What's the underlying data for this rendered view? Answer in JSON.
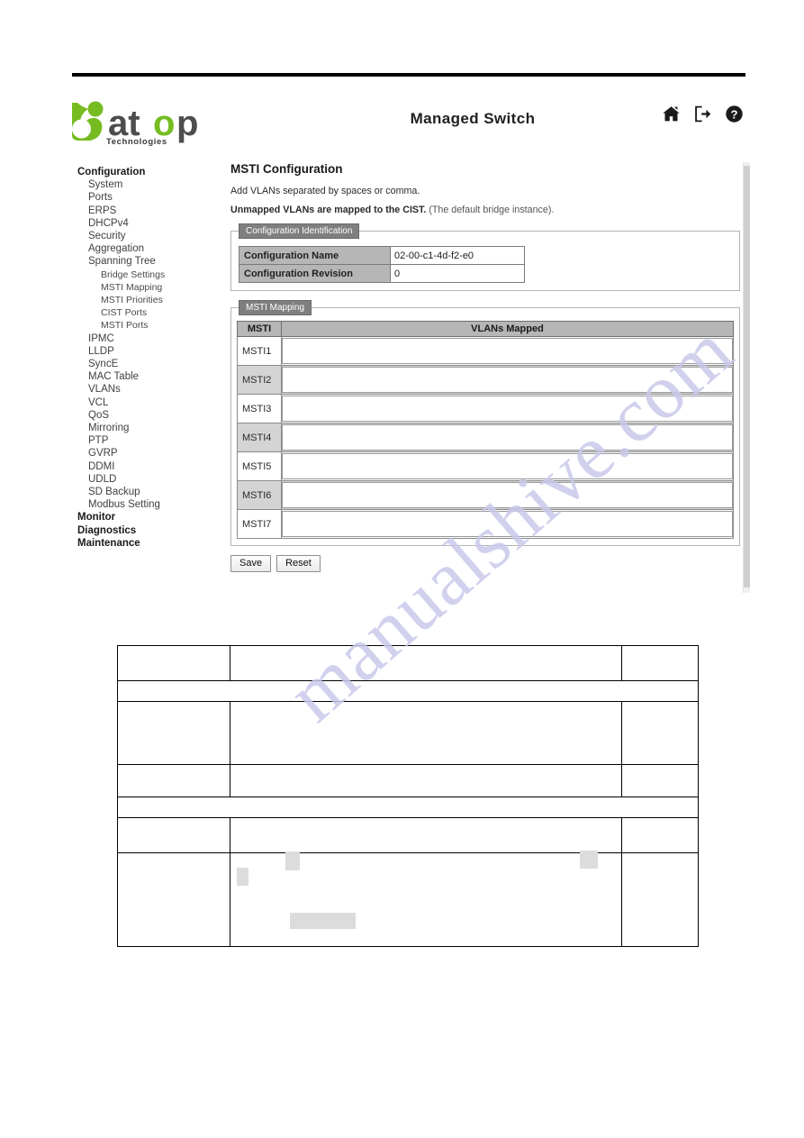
{
  "header": {
    "logo_text": "atop",
    "logo_sub": "Technologies",
    "app_title": "Managed Switch",
    "icons": [
      {
        "name": "home-icon",
        "label": "Home"
      },
      {
        "name": "logout-icon",
        "label": "Logout"
      },
      {
        "name": "help-icon",
        "label": "Help"
      }
    ]
  },
  "sidebar": {
    "items": [
      {
        "label": "Configuration",
        "level": 0
      },
      {
        "label": "System",
        "level": 1
      },
      {
        "label": "Ports",
        "level": 1
      },
      {
        "label": "ERPS",
        "level": 1
      },
      {
        "label": "DHCPv4",
        "level": 1
      },
      {
        "label": "Security",
        "level": 1
      },
      {
        "label": "Aggregation",
        "level": 1
      },
      {
        "label": "Spanning Tree",
        "level": 1
      },
      {
        "label": "Bridge Settings",
        "level": 2
      },
      {
        "label": "MSTI Mapping",
        "level": 2
      },
      {
        "label": "MSTI Priorities",
        "level": 2
      },
      {
        "label": "CIST Ports",
        "level": 2
      },
      {
        "label": "MSTI Ports",
        "level": 2
      },
      {
        "label": "IPMC",
        "level": 1
      },
      {
        "label": "LLDP",
        "level": 1
      },
      {
        "label": "SyncE",
        "level": 1
      },
      {
        "label": "MAC Table",
        "level": 1
      },
      {
        "label": "VLANs",
        "level": 1
      },
      {
        "label": "VCL",
        "level": 1
      },
      {
        "label": "QoS",
        "level": 1
      },
      {
        "label": "Mirroring",
        "level": 1
      },
      {
        "label": "PTP",
        "level": 1
      },
      {
        "label": "GVRP",
        "level": 1
      },
      {
        "label": "DDMI",
        "level": 1
      },
      {
        "label": "UDLD",
        "level": 1
      },
      {
        "label": "SD Backup",
        "level": 1
      },
      {
        "label": "Modbus Setting",
        "level": 1
      },
      {
        "label": "Monitor",
        "level": 0
      },
      {
        "label": "Diagnostics",
        "level": 0
      },
      {
        "label": "Maintenance",
        "level": 0
      }
    ]
  },
  "content": {
    "heading": "MSTI Configuration",
    "hint_1": "Add VLANs separated by spaces or comma.",
    "hint_2_bold": "Unmapped VLANs",
    "hint_2_mid": " are mapped to the CIST.",
    "hint_2_paren": " (The default bridge instance).",
    "config_identification": {
      "legend": "Configuration Identification",
      "rows": [
        {
          "label": "Configuration Name",
          "value": "02-00-c1-4d-f2-e0",
          "placeholder": ""
        },
        {
          "label": "Configuration Revision",
          "value": "0",
          "placeholder": ""
        }
      ]
    },
    "msti_mapping": {
      "legend": "MSTI Mapping",
      "columns": [
        "MSTI",
        "VLANs Mapped"
      ],
      "rows": [
        {
          "msti": "MSTI1",
          "vlans": ""
        },
        {
          "msti": "MSTI2",
          "vlans": ""
        },
        {
          "msti": "MSTI3",
          "vlans": ""
        },
        {
          "msti": "MSTI4",
          "vlans": ""
        },
        {
          "msti": "MSTI5",
          "vlans": ""
        },
        {
          "msti": "MSTI6",
          "vlans": ""
        },
        {
          "msti": "MSTI7",
          "vlans": ""
        }
      ]
    },
    "buttons": {
      "save": "Save",
      "reset": "Reset"
    }
  },
  "watermark": {
    "text": "manualshive.com"
  },
  "colors": {
    "logo_green": "#76bc21",
    "logo_dark": "#4d4d4d",
    "panel_legend_bg": "#7f7f7f",
    "table_header_bg": "#b6b6b6",
    "row_alt_bg": "#d4d4d4",
    "watermark": "#c9c9ec"
  }
}
